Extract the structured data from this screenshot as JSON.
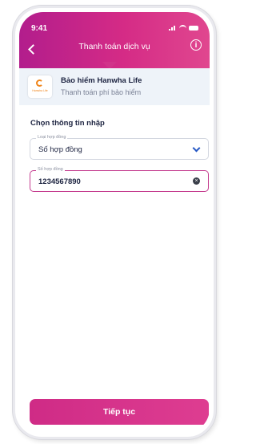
{
  "status": {
    "time": "9:41"
  },
  "header": {
    "title": "Thanh toán dịch vụ"
  },
  "provider": {
    "name": "Bảo hiểm Hanwha Life",
    "subtitle": "Thanh toán phí bảo hiểm",
    "logo_text": "Hanwha Life"
  },
  "form": {
    "section_title": "Chọn thông tin nhập",
    "contract_type": {
      "label": "Loại hợp đồng",
      "value": "Số hợp đồng"
    },
    "contract_number": {
      "label": "Số hợp đồng",
      "value": "1234567890"
    }
  },
  "actions": {
    "continue_label": "Tiếp tục"
  },
  "colors": {
    "primary": "#d52b86",
    "select_chevron": "#2658c4"
  },
  "icons": [
    "back-icon",
    "info-icon",
    "chevron-down-icon",
    "clear-icon"
  ]
}
